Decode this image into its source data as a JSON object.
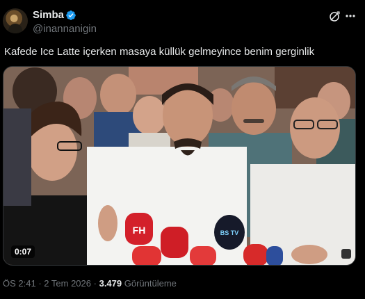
{
  "author": {
    "display_name": "Simba",
    "handle": "@inannanigin",
    "verified": true
  },
  "post": {
    "text": "Kafede Ice Latte içerken masaya küllük gelmeyince benim gerginlik"
  },
  "media": {
    "type": "video",
    "timestamp": "0:07",
    "microphone_logos": [
      "FH",
      "BS TV"
    ]
  },
  "meta": {
    "time": "ÖS 2:41",
    "separator": "·",
    "date": "2 Tem 2026",
    "views_count": "3.479",
    "views_label": "Görüntüleme"
  },
  "colors": {
    "background": "#000000",
    "text": "#e7e9ea",
    "secondary": "#71767b",
    "verified": "#1d9bf0"
  }
}
